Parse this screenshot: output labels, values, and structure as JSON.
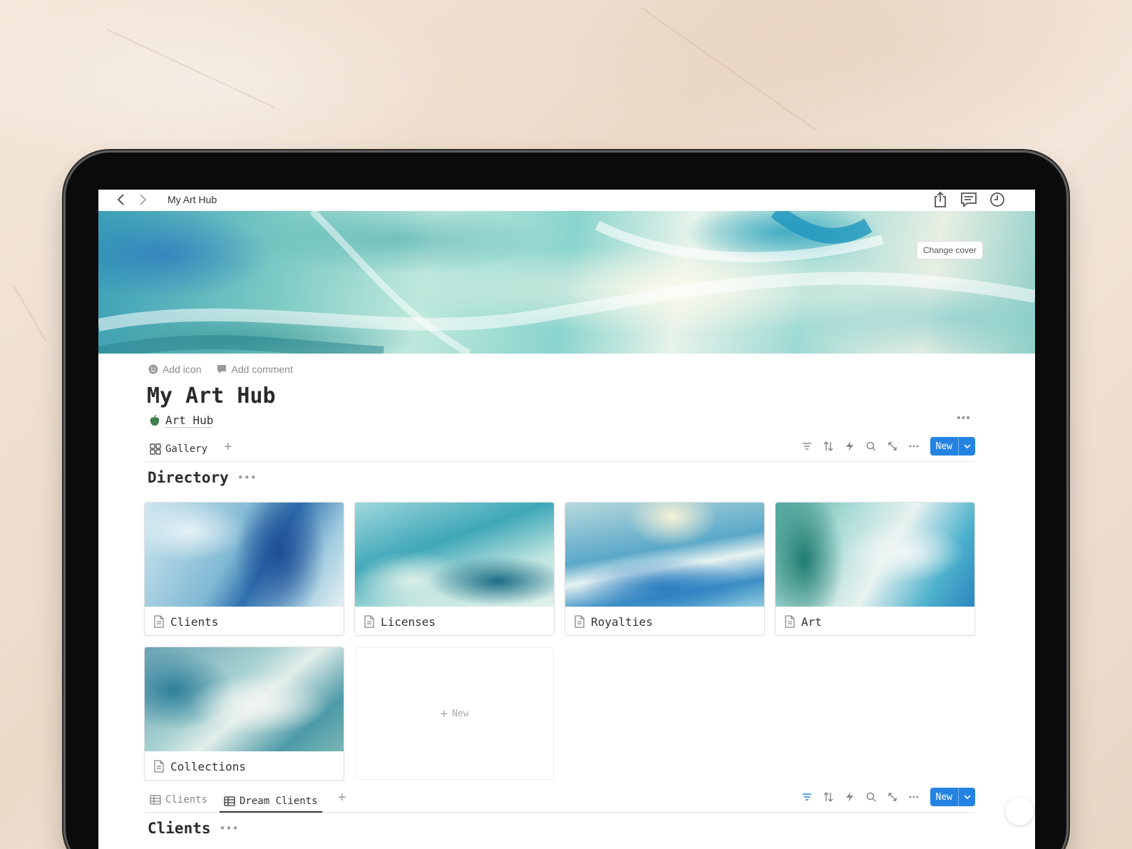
{
  "topbar": {
    "breadcrumb": "My Art Hub"
  },
  "cover": {
    "change_cover_label": "Change cover"
  },
  "page": {
    "add_icon_label": "Add icon",
    "add_comment_label": "Add comment",
    "title": "My Art Hub",
    "subpage_label": "Art Hub"
  },
  "directory_view": {
    "tabs": [
      {
        "label": "Gallery"
      }
    ],
    "new_label": "New",
    "section_title": "Directory",
    "cards": [
      {
        "label": "Clients"
      },
      {
        "label": "Licenses"
      },
      {
        "label": "Royalties"
      },
      {
        "label": "Art"
      },
      {
        "label": "Collections"
      }
    ],
    "add_card_label": "New"
  },
  "clients_view": {
    "tabs": [
      {
        "label": "Clients"
      },
      {
        "label": "Dream Clients"
      }
    ],
    "new_label": "New",
    "section_title": "Clients"
  },
  "colors": {
    "accent": "#2483e2",
    "filter_active": "#2483e2"
  }
}
